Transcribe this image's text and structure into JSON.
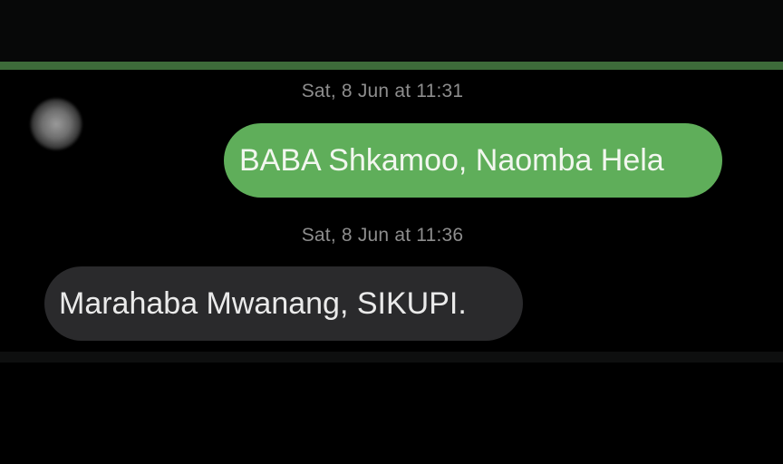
{
  "header": {
    "accent_color": "#3d6b3a"
  },
  "contact": {
    "avatar_icon": "avatar-placeholder-icon"
  },
  "messages": [
    {
      "timestamp": "Sat, 8 Jun at 11:31",
      "direction": "outgoing",
      "text": "BABA Shkamoo, Naomba Hela",
      "bubble_color": "#5fae5a"
    },
    {
      "timestamp": "Sat, 8 Jun at 11:36",
      "direction": "incoming",
      "text": "Marahaba Mwanang, SIKUPI.",
      "bubble_color": "#2a2a2c"
    }
  ]
}
